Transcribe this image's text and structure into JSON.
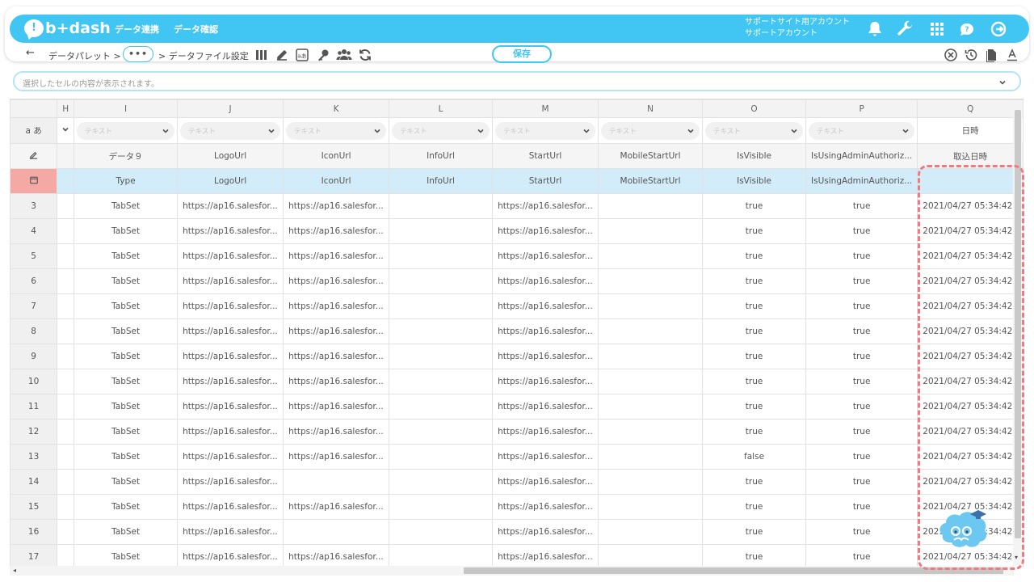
{
  "app": {
    "logo_mark": "!",
    "logo_text": "b+dash"
  },
  "nav": {
    "link1": "データ連携",
    "link2": "データ確認"
  },
  "account": {
    "line1": "サポートサイト用アカウント",
    "line2": "サポートアカウント"
  },
  "toolbar": {
    "back_glyph": "←",
    "crumb1": "データパレット  >",
    "dots": "•••",
    "crumb2": ">  データファイル設定",
    "save_label": "保存"
  },
  "cellbar": {
    "placeholder": "選択したセルの内容が表示されます。"
  },
  "grid": {
    "columns": [
      "H",
      "I",
      "J",
      "K",
      "L",
      "M",
      "N",
      "O",
      "P",
      "Q"
    ],
    "row_labels": {
      "type": "a あ"
    },
    "type_placeholder": "テキスト",
    "q_type": "日時",
    "names": [
      "",
      "データ９",
      "LogoUrl",
      "IconUrl",
      "InfoUrl",
      "StartUrl",
      "MobileStartUrl",
      "IsVisible",
      "IsUsingAdminAuthoriz...",
      "取込日時"
    ],
    "sources": [
      "",
      "Type",
      "LogoUrl",
      "IconUrl",
      "InfoUrl",
      "StartUrl",
      "MobileStartUrl",
      "IsVisible",
      "IsUsingAdminAuthoriz...",
      ""
    ],
    "rows": [
      {
        "n": "3",
        "I": "TabSet",
        "J": "https://ap16.salesfor...",
        "K": "https://ap16.salesfor...",
        "L": "",
        "M": "https://ap16.salesfor...",
        "N": "",
        "O": "true",
        "P": "true",
        "Q": "2021/04/27 05:34:42"
      },
      {
        "n": "4",
        "I": "TabSet",
        "J": "https://ap16.salesfor...",
        "K": "https://ap16.salesfor...",
        "L": "",
        "M": "https://ap16.salesfor...",
        "N": "",
        "O": "true",
        "P": "true",
        "Q": "2021/04/27 05:34:42"
      },
      {
        "n": "5",
        "I": "TabSet",
        "J": "https://ap16.salesfor...",
        "K": "https://ap16.salesfor...",
        "L": "",
        "M": "https://ap16.salesfor...",
        "N": "",
        "O": "true",
        "P": "true",
        "Q": "2021/04/27 05:34:42"
      },
      {
        "n": "6",
        "I": "TabSet",
        "J": "https://ap16.salesfor...",
        "K": "https://ap16.salesfor...",
        "L": "",
        "M": "https://ap16.salesfor...",
        "N": "",
        "O": "true",
        "P": "true",
        "Q": "2021/04/27 05:34:42"
      },
      {
        "n": "7",
        "I": "TabSet",
        "J": "https://ap16.salesfor...",
        "K": "https://ap16.salesfor...",
        "L": "",
        "M": "https://ap16.salesfor...",
        "N": "",
        "O": "true",
        "P": "true",
        "Q": "2021/04/27 05:34:42"
      },
      {
        "n": "8",
        "I": "TabSet",
        "J": "https://ap16.salesfor...",
        "K": "https://ap16.salesfor...",
        "L": "",
        "M": "https://ap16.salesfor...",
        "N": "",
        "O": "true",
        "P": "true",
        "Q": "2021/04/27 05:34:42"
      },
      {
        "n": "9",
        "I": "TabSet",
        "J": "https://ap16.salesfor...",
        "K": "https://ap16.salesfor...",
        "L": "",
        "M": "https://ap16.salesfor...",
        "N": "",
        "O": "true",
        "P": "true",
        "Q": "2021/04/27 05:34:42"
      },
      {
        "n": "10",
        "I": "TabSet",
        "J": "https://ap16.salesfor...",
        "K": "https://ap16.salesfor...",
        "L": "",
        "M": "https://ap16.salesfor...",
        "N": "",
        "O": "true",
        "P": "true",
        "Q": "2021/04/27 05:34:42"
      },
      {
        "n": "11",
        "I": "TabSet",
        "J": "https://ap16.salesfor...",
        "K": "https://ap16.salesfor...",
        "L": "",
        "M": "https://ap16.salesfor...",
        "N": "",
        "O": "true",
        "P": "true",
        "Q": "2021/04/27 05:34:42"
      },
      {
        "n": "12",
        "I": "TabSet",
        "J": "https://ap16.salesfor...",
        "K": "https://ap16.salesfor...",
        "L": "",
        "M": "https://ap16.salesfor...",
        "N": "",
        "O": "true",
        "P": "true",
        "Q": "2021/04/27 05:34:42"
      },
      {
        "n": "13",
        "I": "TabSet",
        "J": "https://ap16.salesfor...",
        "K": "https://ap16.salesfor...",
        "L": "",
        "M": "https://ap16.salesfor...",
        "N": "",
        "O": "false",
        "P": "true",
        "Q": "2021/04/27 05:34:42"
      },
      {
        "n": "14",
        "I": "TabSet",
        "J": "https://ap16.salesfor...",
        "K": "",
        "L": "",
        "M": "https://ap16.salesfor...",
        "N": "",
        "O": "true",
        "P": "true",
        "Q": "2021/04/27 05:34:42"
      },
      {
        "n": "15",
        "I": "TabSet",
        "J": "https://ap16.salesfor...",
        "K": "https://ap16.salesfor...",
        "L": "",
        "M": "https://ap16.salesfor...",
        "N": "",
        "O": "true",
        "P": "true",
        "Q": "2021/04/27 05:34:42"
      },
      {
        "n": "16",
        "I": "TabSet",
        "J": "https://ap16.salesfor...",
        "K": "",
        "L": "",
        "M": "https://ap16.salesfor...",
        "N": "",
        "O": "true",
        "P": "true",
        "Q": "2021/04/27 05:34:42"
      },
      {
        "n": "17",
        "I": "TabSet",
        "J": "https://ap16.salesfor...",
        "K": "https://ap16.salesfor...",
        "L": "",
        "M": "https://ap16.salesfor...",
        "N": "",
        "O": "true",
        "P": "true",
        "Q": "2021/04/27 05:34:42"
      }
    ]
  },
  "colors": {
    "brand": "#41c5f2",
    "source_row": "#d3ecfa",
    "source_marker": "#f5a9a4",
    "highlight": "#f07a80"
  },
  "icons": [
    "bell-icon",
    "wrench-icon",
    "grid-apps-icon",
    "chat-help-icon",
    "logout-icon",
    "columns-icon",
    "edit-icon",
    "translate-icon",
    "key-icon",
    "users-icon",
    "refresh-icon",
    "clear-icon",
    "history-icon",
    "file-icon",
    "text-format-icon",
    "chevron-down-icon"
  ]
}
